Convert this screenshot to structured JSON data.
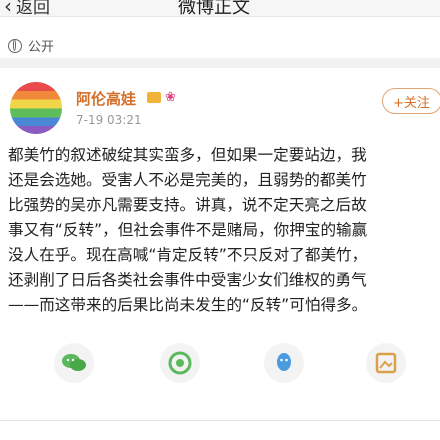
{
  "header": {
    "back_label": "返回",
    "title": "微博正文"
  },
  "post": {
    "privacy": "公开",
    "username": "阿伦高娃",
    "timestamp": "7-19 03:21",
    "follow_label": "+关注",
    "lines": [
      "都美竹的叙述破绽其实蛮多，但如果一定要站边，我",
      "还是会选她。受害人不必是完美的，且弱势的都美竹",
      "比强势的吴亦凡需要支持。讲真，说不定天亮之后故",
      "事又有“反转”，但社会事件不是赌局，你押宝的输赢",
      "没人在乎。现在高喊“肯定反转”不只反对了都美竹，",
      "还剥削了日后各类社会事件中受害少女们维权的勇气",
      "——而这带来的后果比尚未发生的“反转”可怕得多。"
    ]
  },
  "share_icons": [
    "wechat-icon",
    "moments-icon",
    "qq-icon",
    "save-image-icon"
  ],
  "colors": {
    "accent": "#d4702a",
    "wechat": "#5cb85c",
    "qq": "#4a9be0",
    "save": "#d9a14a"
  }
}
